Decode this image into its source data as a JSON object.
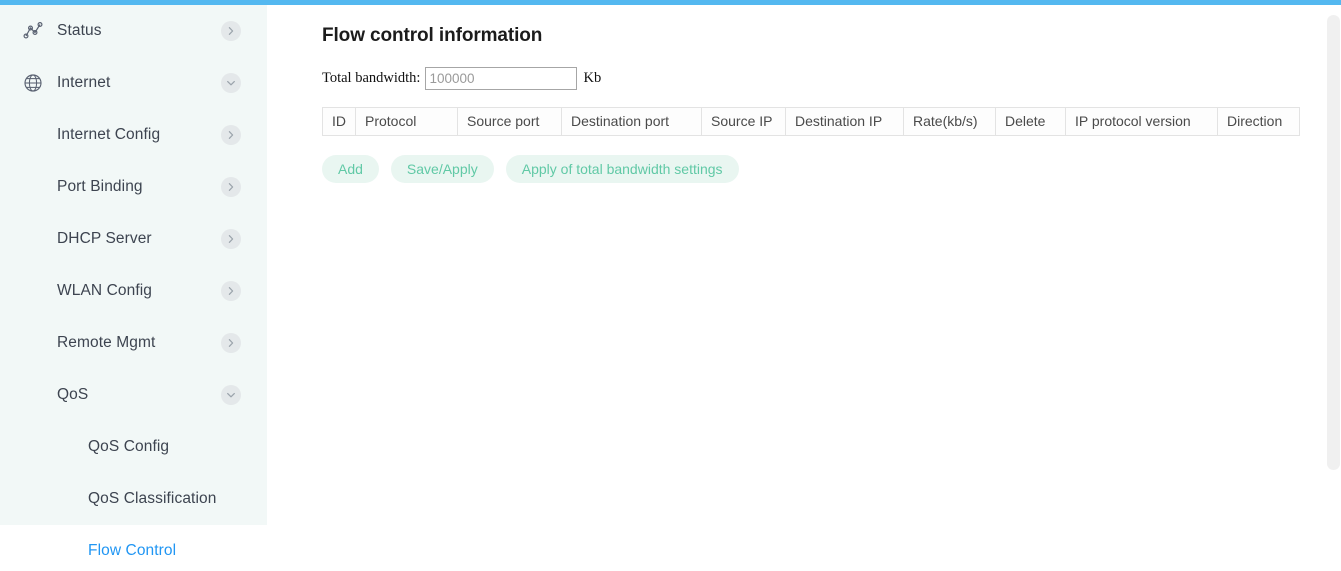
{
  "theme": {
    "accent_bar": "#54b8f0",
    "sidebar_bg": "#f2f8f7",
    "active_link": "#2196f3",
    "button_bg": "#e9f6f1",
    "button_text": "#61c9a6"
  },
  "sidebar": {
    "items": [
      {
        "label": "Status",
        "icon": "activity-chart-icon",
        "level": 0,
        "chevron": "right",
        "active": false
      },
      {
        "label": "Internet",
        "icon": "globe-icon",
        "level": 0,
        "chevron": "down",
        "active": false
      },
      {
        "label": "Internet Config",
        "icon": "",
        "level": 1,
        "chevron": "right",
        "active": false
      },
      {
        "label": "Port Binding",
        "icon": "",
        "level": 1,
        "chevron": "right",
        "active": false
      },
      {
        "label": "DHCP Server",
        "icon": "",
        "level": 1,
        "chevron": "right",
        "active": false
      },
      {
        "label": "WLAN Config",
        "icon": "",
        "level": 1,
        "chevron": "right",
        "active": false
      },
      {
        "label": "Remote Mgmt",
        "icon": "",
        "level": 1,
        "chevron": "right",
        "active": false
      },
      {
        "label": "QoS",
        "icon": "",
        "level": 1,
        "chevron": "down",
        "active": false
      },
      {
        "label": "QoS Config",
        "icon": "",
        "level": 2,
        "chevron": "",
        "active": false
      },
      {
        "label": "QoS Classification",
        "icon": "",
        "level": 2,
        "chevron": "",
        "active": false
      },
      {
        "label": "Flow Control",
        "icon": "",
        "level": 2,
        "chevron": "",
        "active": true
      }
    ]
  },
  "main": {
    "title": "Flow control information",
    "bandwidth": {
      "label": "Total bandwidth:",
      "value": "100000",
      "placeholder": "100000",
      "unit": "Kb"
    },
    "table": {
      "columns": [
        {
          "label": "ID",
          "width": 32
        },
        {
          "label": "Protocol",
          "width": 102
        },
        {
          "label": "Source port",
          "width": 104
        },
        {
          "label": "Destination port",
          "width": 140
        },
        {
          "label": "Source IP",
          "width": 84
        },
        {
          "label": "Destination IP",
          "width": 118
        },
        {
          "label": "Rate(kb/s)",
          "width": 92
        },
        {
          "label": "Delete",
          "width": 70
        },
        {
          "label": "IP protocol version",
          "width": 152
        },
        {
          "label": "Direction",
          "width": 82
        }
      ],
      "rows": []
    },
    "buttons": [
      {
        "label": "Add"
      },
      {
        "label": "Save/Apply"
      },
      {
        "label": "Apply of total bandwidth settings"
      }
    ]
  }
}
